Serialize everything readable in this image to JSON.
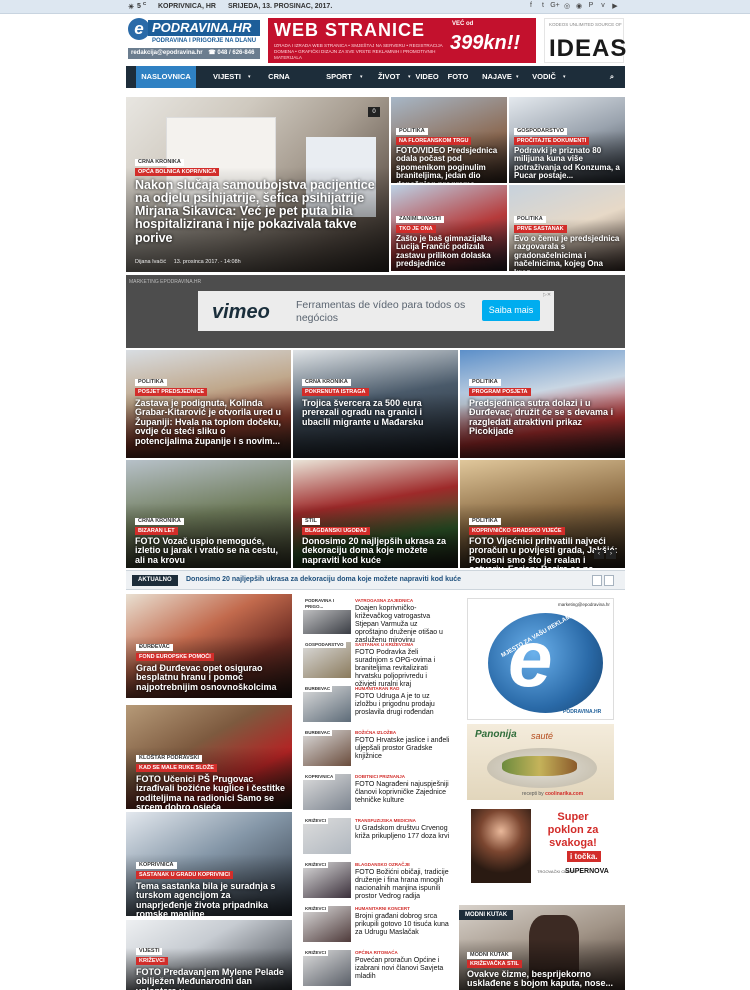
{
  "topbar": {
    "location": "KOPRIVNICA, HR",
    "temperature": "5",
    "degree_unit": "C",
    "date": "SRIJEDA, 13. PROSINAC, 2017.",
    "social_icons": [
      "facebook-icon",
      "twitter-icon",
      "googleplus-icon",
      "instagram-icon",
      "rss-icon",
      "pinterest-icon",
      "vimeo-icon",
      "youtube-icon"
    ],
    "social_glyphs": [
      "f",
      "t",
      "G+",
      "◎",
      "◉",
      "P",
      "v",
      "▶"
    ]
  },
  "logo": {
    "letter": "e",
    "name": "PODRAVINA.HR",
    "tagline": "PODRAVINA I PRIGORJE NA DLANU",
    "email": "redakcija@epodravina.hr",
    "phone": "048 / 626-846"
  },
  "ads_header": {
    "web_title": "WEB STRANICE",
    "web_small": "IZRADA I IZRADA WEB STRANICA • SMJEŠTAJ NA SERVERU • REGISTRACIJA DOMENA • GRAFIČKI DIZAJN ZA SVE VRSTE REKLAMNIH I PROMOTIVNIH MATERIJALA",
    "web_price_prefix": "VEĆ od",
    "web_price": "399kn!!",
    "ideas_small": "KODEOS UNLIMITED SOURCE OF",
    "ideas_big": "IDEAS"
  },
  "nav": {
    "items": [
      "NASLOVNICA",
      "VIJESTI",
      "CRNA KRONIKA",
      "SPORT",
      "ŽIVOT",
      "VIDEO",
      "FOTO",
      "NAJAVE",
      "VODIČ"
    ],
    "search_icon": "search-icon"
  },
  "hero": {
    "comments": "0",
    "cat_top": "CRNA KRONIKA",
    "cat": "OPĆA BOLNICA KOPRIVNICA",
    "title": "Nakon slučaja samoubojstva pacijentice na odjelu psihijatrije, šefica psihijatrije Mirjana Sikavica: Već je pet puta bila hospitalizirana i nije pokazivala takve porive",
    "author": "Dijana Ivačić",
    "date": "13. prosinca 2017. - 14:08h"
  },
  "hero_side": [
    {
      "cat_top": "POLITIKA",
      "cat": "NA FLOREANSKOM TRGU",
      "title": "FOTO/VIDEO Predsjednica odala počast pod spomenikom poginulim braniteljima, jedan dio današnjeg programa otkazan"
    },
    {
      "cat_top": "GOSPODARSTVO",
      "cat": "PROČITAJTE DOKUMENTI",
      "title": "Podravki je priznato 80 milijuna kuna više potraživanja od Konzuma, a Pucar postaje..."
    },
    {
      "cat_top": "ZANIMLJIVOSTI",
      "cat": "TKO JE ONA",
      "title": "Zašto je baš gimnazijalka Lucija Frančić podizala zastavu prilikom dolaska predsjednice"
    },
    {
      "cat_top": "POLITIKA",
      "cat": "PRVE SASTANAK",
      "title": "Evo o čemu je predsjednica razgovarala s gradonačelnicima i načelnicima, kojeg Ona kroz..."
    }
  ],
  "ad_marketing": {
    "label": "MARKETING EPODRAVINA.HR",
    "logo": "vimeo",
    "text": "Ferramentas de vídeo para todos os negócios",
    "button": "Saiba mais"
  },
  "grid": [
    {
      "cat_top": "POLITIKA",
      "cat": "POSJET PREDSJEDNICE",
      "title": "Zastava je podignuta, Kolinda Grabar-Kitarović je otvorila ured u Županiji: Hvala na toplom dočeku, ovdje ću steći sliku o potencijalima županije i s novim..."
    },
    {
      "cat_top": "CRNA KRONIKA",
      "cat": "POKRENUTA ISTRAGA",
      "title": "Trojica švercera za 500 eura prerezali ogradu na granici i ubacili migrante u Mađarsku"
    },
    {
      "cat_top": "POLITIKA",
      "cat": "PROGRAM POSJETA",
      "title": "Predsjednica sutra dolazi i u Đurđevac, družit će se s devama i razgledati atraktivni prikaz Picokijade"
    },
    {
      "cat_top": "CRNA KRONIKA",
      "cat": "BIZARAN LET",
      "title": "FOTO Vozač uspio nemoguće, izletio u jarak i vratio se na cestu, ali na krovu"
    },
    {
      "cat_top": "STIL",
      "cat": "BLAGDANSKI UGOĐAJ",
      "title": "Donosimo 20 najljepših ukrasa za dekoraciju doma koje možete napraviti kod kuće"
    },
    {
      "cat_top": "POLITIKA",
      "cat": "KOPRIVNIČKO GRADSKO VIJEĆE",
      "title": "FOTO Vijećnici prihvatili najveći proračun u povijesti grada, Jakšić: Ponosni smo što je realan i ostvariv, Forjan: Bazira se na smeću, bez rekorda, kriterija..."
    }
  ],
  "ticker": {
    "label": "AKTUALNO",
    "text": "Donosimo 20 najljepših ukrasa za dekoraciju doma koje možete napraviti kod kuće"
  },
  "vijesti": {
    "label": "VIJESTI",
    "items": [
      {
        "cat_top": "ĐURĐEVAC",
        "cat": "FOND EUROPSKE POMOĆI",
        "title": "Grad Đurđevac opet osigurao besplatnu hranu i pomoć najpotrebnijim osnovnoškolcima"
      },
      {
        "cat_top": "KLOŠTAR PODRAVSKI",
        "cat": "KAD SE MALE RUKE SLOŽE",
        "title": "FOTO Učenici PŠ Prugovac izrađivali božićne kuglice i čestitke roditeljima na radionici Samo se srcem dobro osjeća"
      },
      {
        "cat_top": "KOPRIVNICA",
        "cat": "SASTANAK U GRADU KOPRIVNICI",
        "title": "Tema sastanka bila je suradnja s turskom agencijom za unaprjeđenje života pripadnika romske manjine"
      },
      {
        "cat_top": "VIJESTI",
        "cat": "KRIŽEVCI",
        "title": "FOTO Predavanjem Mylene Pelade obilježen Međunarodni dan volontera u"
      }
    ]
  },
  "list": [
    {
      "thumb": "PODRAVINA I PRIGO...",
      "cat": "VATROGASNA ZAJEDNICA",
      "title": "Doajen koprivničko-križevačkog vatrogastva Stjepan Varmuža uz oproštajno druženje otišao u zasluženu mirovinu"
    },
    {
      "thumb": "GOSPODARSTVO",
      "cat": "SASTANAK U KRIŽEVCIMA",
      "title": "FOTO Podravka želi suradnjom s OPG-ovima i braniteljima revitalizirati hrvatsku poljoprivredu i oživjeti ruralni kraj"
    },
    {
      "thumb": "ĐURĐEVAC",
      "cat": "HUMANITARAN RAD",
      "title": "FOTO Udruga A je to uz izložbu i prigodnu prodaju proslavila drugi rođendan"
    },
    {
      "thumb": "ĐURĐEVAC",
      "cat": "BOŽIĆNA IZLOŽBA",
      "title": "FOTO Hrvatske jaslice i anđeli uljepšali prostor Gradske knjižnice"
    },
    {
      "thumb": "KOPRIVNICA",
      "cat": "DOBITNICI PRIZNANJA",
      "title": "FOTO Nagrađeni najuspješniji članovi koprivničke Zajednice tehničke kulture"
    },
    {
      "thumb": "KRIŽEVCI",
      "cat": "TRANSFUZIJSKA MEDICINA",
      "title": "U Gradskom društvu Crvenog križa prikupljeno 177 doza krvi"
    },
    {
      "thumb": "KRIŽEVCI",
      "cat": "BLAGDANSKO OZRAČJE",
      "title": "FOTO Božićni običaji, tradicije druženje i fina hrana mnogih nacionalnih manjina ispunili prostor Vedrog radija"
    },
    {
      "thumb": "KRIŽEVCI",
      "cat": "HUMANITARNI KONCERT",
      "title": "Brojni građani dobrog srca prikupili gotovo 10 tisuća kuna za Udrugu Maslačak"
    },
    {
      "thumb": "KRIŽEVCI",
      "cat": "OPĆINA RITOMAĆA",
      "title": "Povećan proračun Općine i izabrani novi članovi Savjeta mladih"
    }
  ],
  "sidebar": {
    "ad1_email": "marketing@epodravina.hr",
    "ad1_text": "MJESTO ZA VAŠU REKLAMU",
    "ad1_letter": "e",
    "ad1_brand": "PODRAVINA.HR",
    "ad2_title": "Panonija",
    "ad2_title2": "sauté",
    "ad2_foot_prefix": "recepti by",
    "ad2_foot": "coolinarika.com",
    "ad3_text1": "Super",
    "ad3_text2": "poklon za",
    "ad3_text3": "svakoga!",
    "ad3_text4": "i točka.",
    "ad3_brand": "SUPERNOVA",
    "ad3_brand_prefix": "TRGOVAČKI CENTRI",
    "modni": {
      "label": "MODNI KUTAK",
      "cat_top": "MODNI KUTAK",
      "cat": "KRIŽEVAČKA STIL",
      "title": "Ovakve čizme, besprijekorno usklađene s bojom kaputa, nose..."
    }
  },
  "colors": {
    "nav_bg": "#1d2d3a",
    "nav_active": "#2f81c3",
    "cat_red": "#d22d2a",
    "ad_red": "#c3112d"
  }
}
